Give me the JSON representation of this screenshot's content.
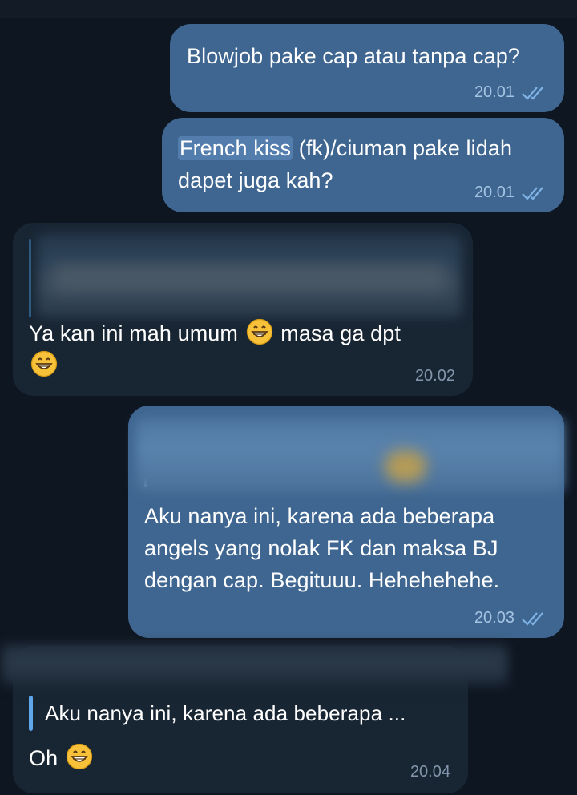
{
  "messages": [
    {
      "text": "Blowjob pake cap atau tanpa cap?",
      "time": "20.01"
    },
    {
      "highlight": "French kiss",
      "line1_rest": " (fk)/ciuman pake lidah",
      "line2": "dapet juga kah?",
      "time": "20.01"
    },
    {
      "line1_before": "Ya kan ini mah umum",
      "line1_after": "masa ga dpt",
      "time": "20.02"
    },
    {
      "line1": "Aku nanya ini, karena ada beberapa",
      "line2": "angels yang nolak FK dan maksa BJ",
      "line3": "dengan cap. Begituuu. Hehehehehe.",
      "time": "20.03"
    },
    {
      "quote": "Aku nanya ini, karena ada beberapa ...",
      "text": "Oh",
      "time": "20.04"
    }
  ],
  "icons": {
    "read_ticks": "double-check-icon",
    "emoji": "grinning-face-icon"
  },
  "colors": {
    "background": "#0e1621",
    "outgoing_bubble": "#3f6690",
    "incoming_bubble": "#182533",
    "reply_accent": "#5fa6ea"
  }
}
